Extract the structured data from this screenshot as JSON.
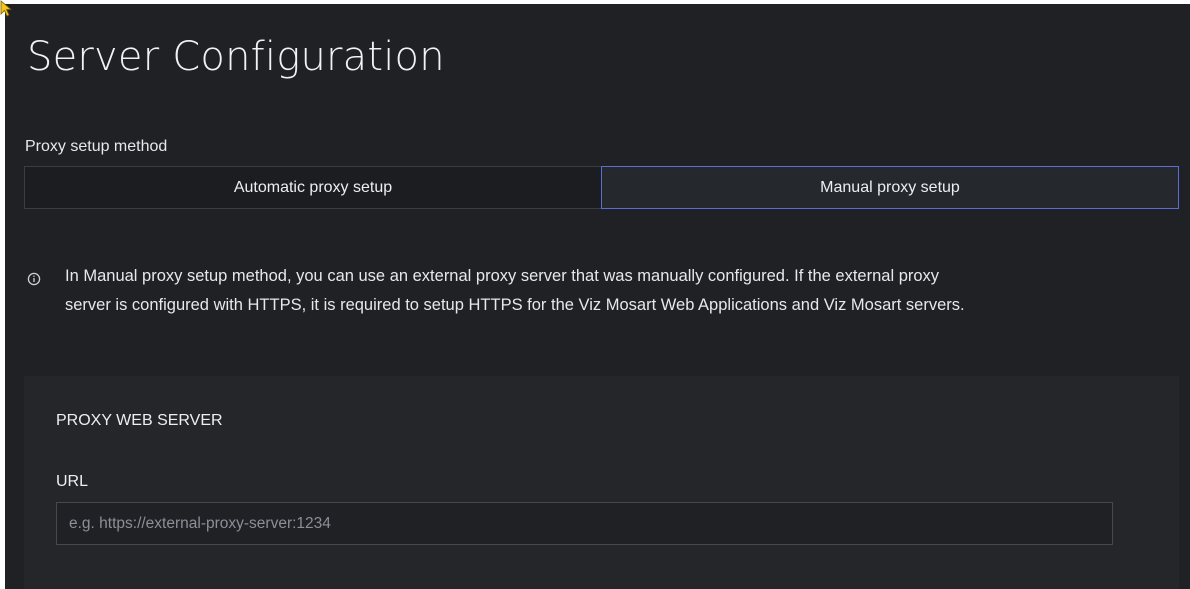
{
  "page": {
    "title": "Server Configuration"
  },
  "proxy_setup": {
    "label": "Proxy setup method",
    "options": [
      {
        "label": "Automatic proxy setup",
        "selected": false
      },
      {
        "label": "Manual proxy setup",
        "selected": true
      }
    ]
  },
  "info": {
    "icon": "info-circle-icon",
    "text_line1": "In Manual proxy setup method, you can use an external proxy server that was manually configured. If the external proxy",
    "text_line2": "server is configured with HTTPS, it is required to setup HTTPS for the Viz Mosart Web Applications and Viz Mosart servers."
  },
  "proxy_web_server": {
    "section_title": "PROXY WEB SERVER",
    "url_label": "URL",
    "url_value": "",
    "url_placeholder": "e.g. https://external-proxy-server:1234"
  },
  "colors": {
    "background": "#1f2124",
    "panel": "#24262a",
    "selected_border": "#5d6bd6",
    "cursor": "#f5c518"
  }
}
